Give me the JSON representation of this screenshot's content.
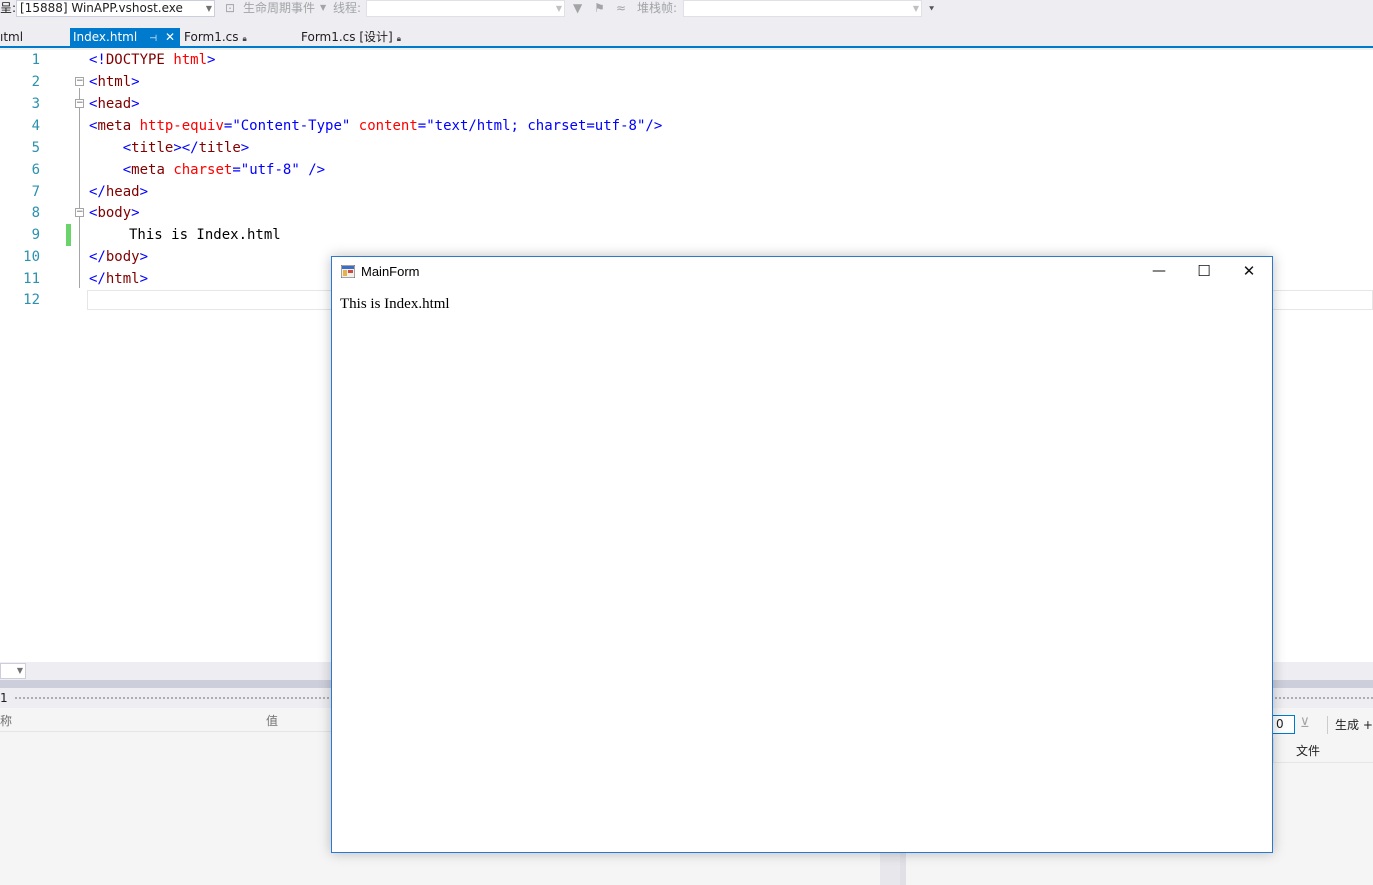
{
  "toolbar": {
    "process_label": "呈:",
    "process_value": "[15888] WinAPP.vshost.exe",
    "lifecycle_label": "生命周期事件",
    "thread_label": "线程:",
    "stackframe_label": "堆栈帧:"
  },
  "tabs": [
    {
      "label": "ıtml"
    },
    {
      "label": "Index.html"
    },
    {
      "label": "Form1.cs"
    },
    {
      "label": "Form1.cs [设计]"
    }
  ],
  "editor": {
    "line_numbers": [
      "1",
      "2",
      "3",
      "4",
      "5",
      "6",
      "7",
      "8",
      "9",
      "10",
      "11",
      "12"
    ],
    "body_text": "This is Index.html"
  },
  "lower": {
    "left_title": "1",
    "left_col_name": "称",
    "left_col_value": "值",
    "right_count": "0",
    "right_build_label": "生成 +",
    "right_col_file": "文件"
  },
  "mainform": {
    "title": "MainForm",
    "content": "This is Index.html",
    "minimize_glyph": "—",
    "maximize_glyph": "☐",
    "close_glyph": "✕"
  }
}
